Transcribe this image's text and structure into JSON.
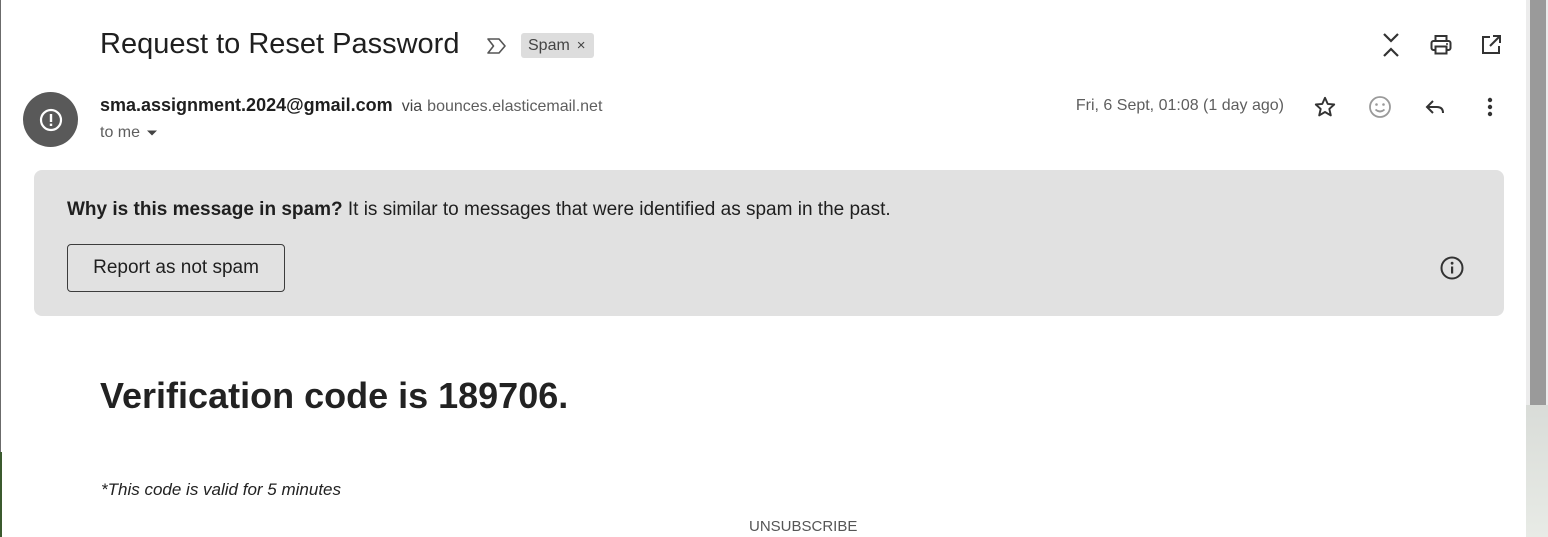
{
  "email": {
    "subject": "Request to Reset Password",
    "label": "Spam",
    "label_remove": "×",
    "sender": {
      "email": "sma.assignment.2024@gmail.com",
      "via_prefix": "via",
      "via_domain": "bounces.elasticemail.net"
    },
    "recipient": "to me",
    "date": "Fri, 6 Sept, 01:08 (1 day ago)"
  },
  "spam_banner": {
    "question": "Why is this message in spam?",
    "reason": "It is similar to messages that were identified as spam in the past.",
    "button_label": "Report as not spam"
  },
  "body": {
    "heading": "Verification code is 189706.",
    "note": "*This code is valid for 5 minutes",
    "unsubscribe": "UNSUBSCRIBE"
  },
  "icons": {
    "collapse": "collapse-all-icon",
    "print": "print-icon",
    "open_new_window": "open-in-new-window-icon",
    "star": "star-icon",
    "emoji": "emoji-reaction-icon",
    "reply": "reply-icon",
    "more": "more-vertical-icon",
    "warning": "spam-warning-icon",
    "info": "info-icon",
    "important": "important-marker-icon"
  },
  "colors": {
    "banner_bg": "#e1e1e1",
    "avatar_bg": "#595959",
    "chip_bg": "#dddddd"
  }
}
